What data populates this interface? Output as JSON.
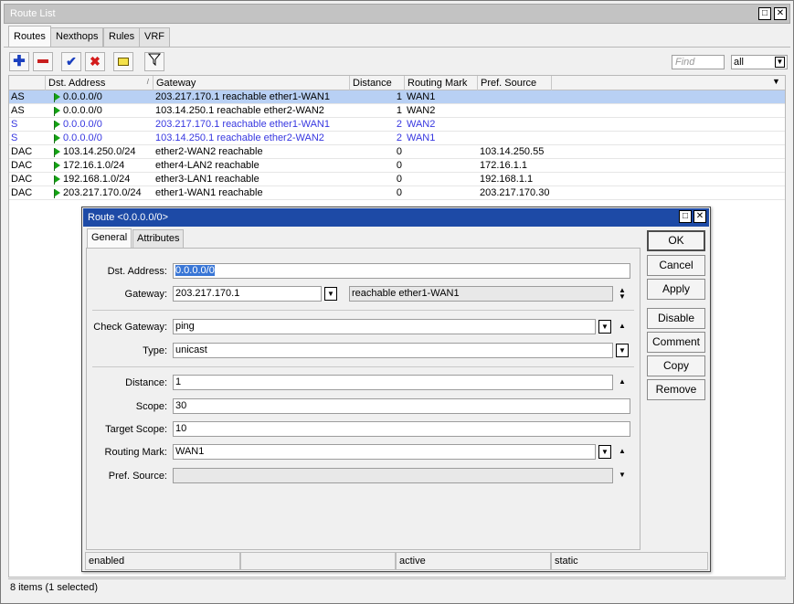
{
  "window": {
    "title": "Route List"
  },
  "tabs": [
    {
      "label": "Routes"
    },
    {
      "label": "Nexthops"
    },
    {
      "label": "Rules"
    },
    {
      "label": "VRF"
    }
  ],
  "toolbar": {
    "find_placeholder": "Find",
    "filter_value": "all",
    "buttons": [
      "add-icon",
      "remove-icon",
      "enable-icon",
      "disable-icon",
      "comment-icon",
      "filter-icon"
    ]
  },
  "table": {
    "columns": [
      "",
      "Dst. Address",
      "Gateway",
      "Distance",
      "Routing Mark",
      "Pref. Source"
    ],
    "sort_indicator": "/",
    "rows": [
      {
        "flags": "AS",
        "dst": "0.0.0.0/0",
        "gateway": "203.217.170.1 reachable ether1-WAN1",
        "distance": "1",
        "mark": "WAN1",
        "pref": "",
        "selected": true,
        "inactive": false,
        "flag": true
      },
      {
        "flags": "AS",
        "dst": "0.0.0.0/0",
        "gateway": "103.14.250.1 reachable ether2-WAN2",
        "distance": "1",
        "mark": "WAN2",
        "pref": "",
        "selected": false,
        "inactive": false,
        "flag": true
      },
      {
        "flags": "S",
        "dst": "0.0.0.0/0",
        "gateway": "203.217.170.1 reachable ether1-WAN1",
        "distance": "2",
        "mark": "WAN2",
        "pref": "",
        "selected": false,
        "inactive": true,
        "flag": true
      },
      {
        "flags": "S",
        "dst": "0.0.0.0/0",
        "gateway": "103.14.250.1 reachable ether2-WAN2",
        "distance": "2",
        "mark": "WAN1",
        "pref": "",
        "selected": false,
        "inactive": true,
        "flag": true
      },
      {
        "flags": "DAC",
        "dst": "103.14.250.0/24",
        "gateway": "ether2-WAN2 reachable",
        "distance": "0",
        "mark": "",
        "pref": "103.14.250.55",
        "selected": false,
        "inactive": false,
        "flag": true
      },
      {
        "flags": "DAC",
        "dst": "172.16.1.0/24",
        "gateway": "ether4-LAN2 reachable",
        "distance": "0",
        "mark": "",
        "pref": "172.16.1.1",
        "selected": false,
        "inactive": false,
        "flag": true
      },
      {
        "flags": "DAC",
        "dst": "192.168.1.0/24",
        "gateway": "ether3-LAN1 reachable",
        "distance": "0",
        "mark": "",
        "pref": "192.168.1.1",
        "selected": false,
        "inactive": false,
        "flag": true
      },
      {
        "flags": "DAC",
        "dst": "203.217.170.0/24",
        "gateway": "ether1-WAN1 reachable",
        "distance": "0",
        "mark": "",
        "pref": "203.217.170.30",
        "selected": false,
        "inactive": false,
        "flag": true
      }
    ]
  },
  "status": {
    "text": "8 items (1 selected)"
  },
  "dialog": {
    "title": "Route <0.0.0.0/0>",
    "tabs": [
      {
        "label": "General"
      },
      {
        "label": "Attributes"
      }
    ],
    "fields": {
      "dst_label": "Dst. Address:",
      "dst_value": "0.0.0.0/0",
      "gateway_label": "Gateway:",
      "gateway_value": "203.217.170.1",
      "gateway_state": "reachable ether1-WAN1",
      "check_label": "Check Gateway:",
      "check_value": "ping",
      "type_label": "Type:",
      "type_value": "unicast",
      "distance_label": "Distance:",
      "distance_value": "1",
      "scope_label": "Scope:",
      "scope_value": "30",
      "target_label": "Target Scope:",
      "target_value": "10",
      "mark_label": "Routing Mark:",
      "mark_value": "WAN1",
      "pref_label": "Pref. Source:",
      "pref_value": ""
    },
    "buttons": {
      "ok": "OK",
      "cancel": "Cancel",
      "apply": "Apply",
      "disable": "Disable",
      "comment": "Comment",
      "copy": "Copy",
      "remove": "Remove"
    },
    "status": {
      "s1": "enabled",
      "s2": "",
      "s3": "active",
      "s4": "static"
    }
  }
}
